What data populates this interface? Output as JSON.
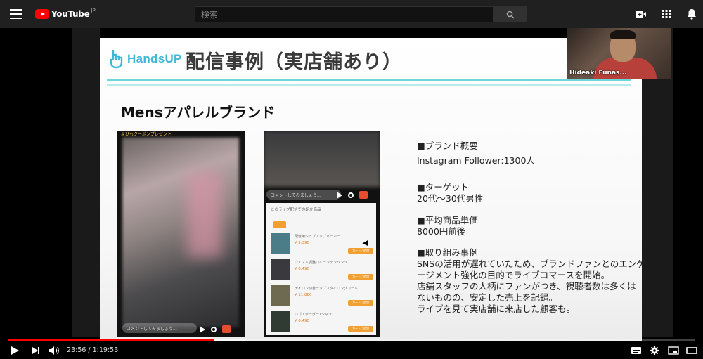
{
  "header": {
    "logo_text": "YouTube",
    "logo_region": "JP",
    "search_placeholder": "検索",
    "icons": [
      "menu-icon",
      "youtube-logo",
      "search-icon",
      "create-video-icon",
      "apps-grid-icon",
      "notifications-bell-icon"
    ]
  },
  "slide": {
    "brand_logo_text": "HandsUP",
    "title": "配信事例（実店舗あり）",
    "section_title": "Mensアパレルブランド",
    "phone1": {
      "caption": "よびもクーポンプレゼント",
      "comment_placeholder": "コメントしてみましょう…"
    },
    "phone2": {
      "comment_placeholder": "コメントしてみましょう…",
      "panel_header": "このライブ配信での紹介商品",
      "items": [
        {
          "name": "配達用ジップアップパーカー",
          "price": "¥ 5,390",
          "button": "カートに追加"
        },
        {
          "name": "ウエスト調整ロイーンテンバンツ",
          "price": "¥ 6,490",
          "button": "カートに追加"
        },
        {
          "name": "ナイロン切替ラップスタイロングコート",
          "price": "¥ 11,880",
          "button": "カートに追加"
        },
        {
          "name": "ロゴ・ボーダーTシャツ",
          "price": "¥ 6,490",
          "button": "カートに追加"
        }
      ]
    },
    "info": {
      "brand_overview_heading": "■ブランド概要",
      "instagram": "Instagram Follower:1300人",
      "target_heading": "■ターゲット",
      "target_value": "20代～30代男性",
      "avg_price_heading": "■平均商品単価",
      "avg_price_value": "8000円前後",
      "initiative_heading": "■取り組み事例",
      "initiative_lines": [
        "SNSの活用が遅れていたため、ブランドファンとのエンゲ",
        "ージメント強化の目的でライブコマースを開始。",
        "店舗スタッフの人柄にファンがつき、視聴者数は多くは",
        "ないものの、安定した売上を記録。",
        "ライブを見て実店舗に来店した顧客も。"
      ]
    }
  },
  "webcam": {
    "name": "Hideaki Funas..."
  },
  "player": {
    "current_time": "23:56",
    "separator": " / ",
    "duration": "1:19:53",
    "time_display": "23:56 / 1:19:53",
    "played_fraction": 0.2996,
    "loaded_fraction": 0.345,
    "accent_color": "#ff0000"
  }
}
